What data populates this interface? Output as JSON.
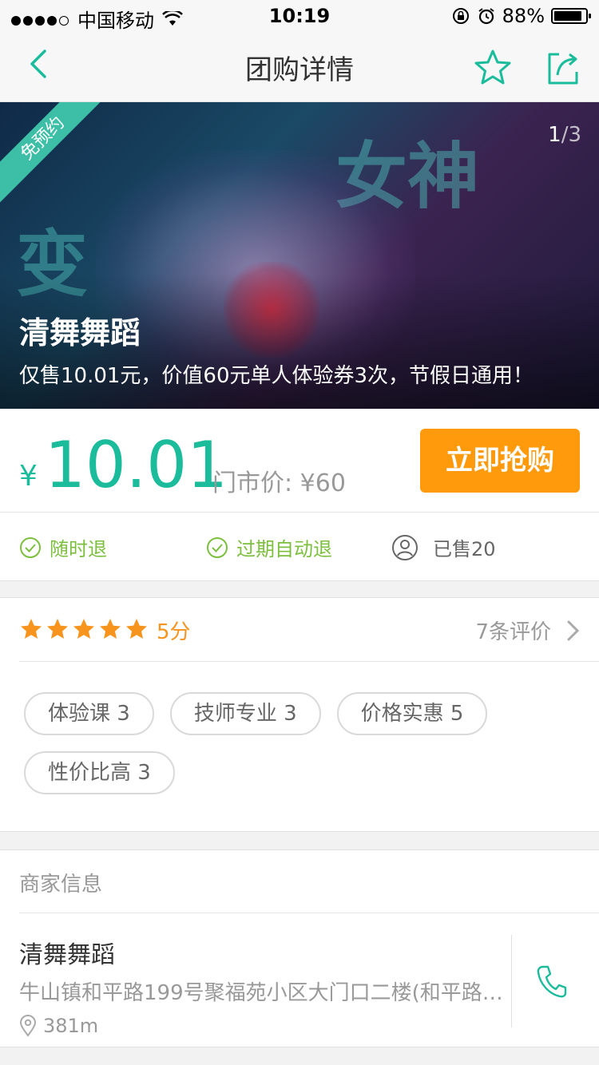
{
  "status_bar": {
    "carrier": "中国移动",
    "time": "10:19",
    "battery": "88%",
    "battery_level": 0.88
  },
  "nav": {
    "title": "团购详情",
    "accent_color": "#1bbc9b"
  },
  "hero": {
    "badge": "免预约",
    "counter_current": "1",
    "counter_total": "/3",
    "shop_name": "清舞舞蹈",
    "description": "仅售10.01元，价值60元单人体验券3次，节假日通用！"
  },
  "pricing": {
    "currency": "¥",
    "price": "10.01",
    "market_price": "门市价: ¥60",
    "buy_button": "立即抢购",
    "buy_button_color": "#ff9a0d"
  },
  "guarantees": {
    "refund_anytime": "随时退",
    "auto_refund": "过期自动退",
    "sold": "已售20"
  },
  "reviews": {
    "stars": 5,
    "score": "5分",
    "count": "7条评价",
    "tags": [
      {
        "label": "体验课 3"
      },
      {
        "label": "技师专业 3"
      },
      {
        "label": "价格实惠 5"
      },
      {
        "label": "性价比高 3"
      }
    ]
  },
  "merchant": {
    "header": "商家信息",
    "name": "清舞舞蹈",
    "address": "牛山镇和平路199号聚福苑小区大门口二楼(和平路…",
    "distance": "381m"
  }
}
